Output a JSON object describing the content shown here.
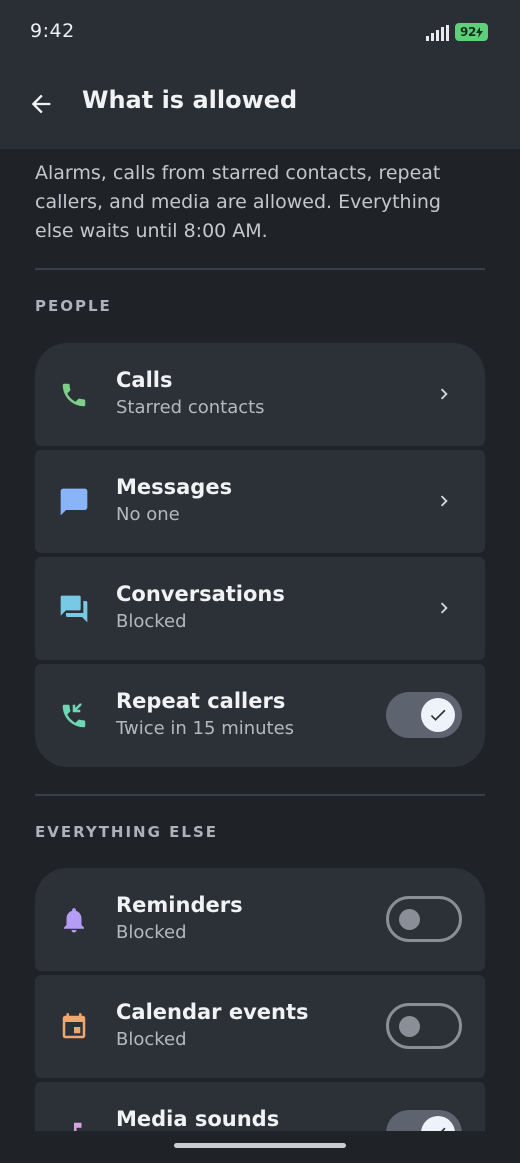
{
  "status_bar": {
    "time": "9:42",
    "battery": "92"
  },
  "app_bar": {
    "title": "What is allowed"
  },
  "intro_text": "Alarms, calls from starred contacts, repeat callers, and media are allowed. Everything else waits until 8:00 AM.",
  "sections": {
    "people": {
      "label": "PEOPLE",
      "rows": [
        {
          "title": "Calls",
          "subtitle": "Starred contacts",
          "icon": "phone-icon",
          "icon_color": "#7dcf8a",
          "control": "chevron"
        },
        {
          "title": "Messages",
          "subtitle": "No one",
          "icon": "message-icon",
          "icon_color": "#8ab4f8",
          "control": "chevron"
        },
        {
          "title": "Conversations",
          "subtitle": "Blocked",
          "icon": "conversation-icon",
          "icon_color": "#78c8e6",
          "control": "chevron"
        },
        {
          "title": "Repeat callers",
          "subtitle": "Twice in 15 minutes",
          "icon": "phone-callback-icon",
          "icon_color": "#6fd6b4",
          "control": "toggle",
          "checked": true
        }
      ]
    },
    "everything_else": {
      "label": "EVERYTHING ELSE",
      "rows": [
        {
          "title": "Reminders",
          "subtitle": "Blocked",
          "icon": "bell-icon",
          "icon_color": "#b59cf5",
          "control": "toggle",
          "checked": false
        },
        {
          "title": "Calendar events",
          "subtitle": "Blocked",
          "icon": "calendar-icon",
          "icon_color": "#f0a673",
          "control": "toggle",
          "checked": false
        },
        {
          "title": "Media sounds",
          "subtitle": "",
          "icon": "music-icon",
          "icon_color": "#d7a3e8",
          "control": "toggle",
          "checked": true
        }
      ]
    }
  }
}
